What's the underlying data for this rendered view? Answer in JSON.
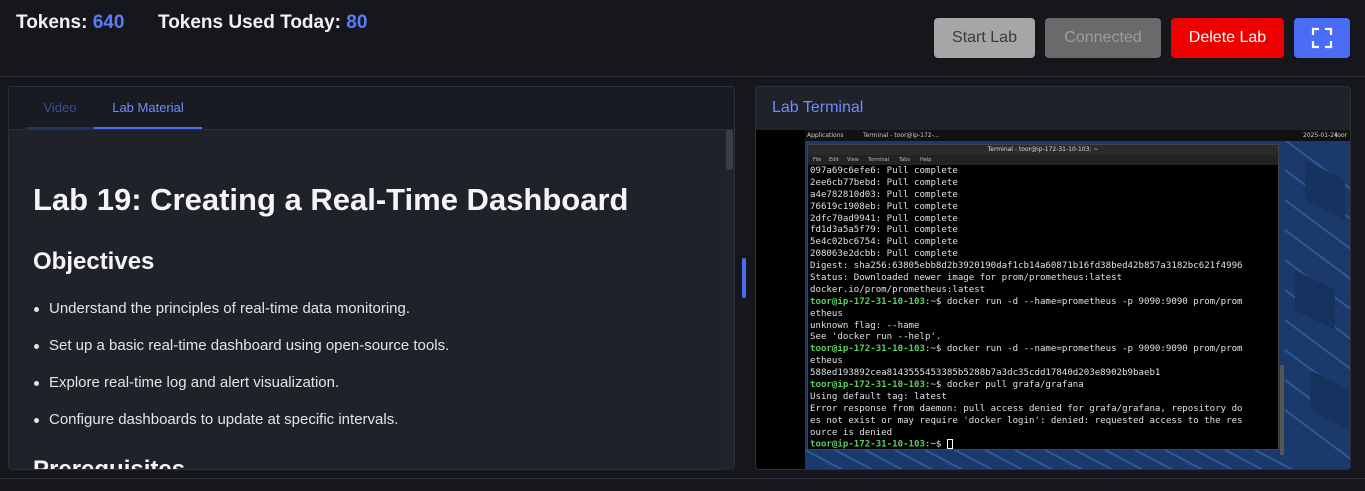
{
  "stats": {
    "tokens_label": "Tokens:",
    "tokens_value": "640",
    "used_label": "Tokens Used Today:",
    "used_value": "80"
  },
  "toolbar": {
    "start_label": "Start Lab",
    "connected_label": "Connected",
    "delete_label": "Delete Lab",
    "fullscreen_icon": "fullscreen-icon"
  },
  "tabs": [
    {
      "label": "Video"
    },
    {
      "label": "Lab Material"
    }
  ],
  "material": {
    "title": "Lab 19: Creating a Real-Time Dashboard",
    "objectives_heading": "Objectives",
    "objectives": [
      "Understand the principles of real-time data monitoring.",
      "Set up a basic real-time dashboard using open-source tools.",
      "Explore real-time log and alert visualization.",
      "Configure dashboards to update at specific intervals."
    ],
    "next_heading": "Prerequisites"
  },
  "terminal_panel": {
    "title": "Lab Terminal",
    "window_title": "Terminal - toor@ip-172-31-10-103: ~",
    "menu": [
      "File",
      "Edit",
      "View",
      "Terminal",
      "Tabs",
      "Help"
    ],
    "os_bar": {
      "apps": "Applications",
      "task": "Terminal - toor@ip-172-...",
      "date": "2025-01-24",
      "user": "toor"
    },
    "prompt": "toor@ip-172-31-10-103",
    "prompt_suffix": ":~$ ",
    "lines": [
      {
        "text": "097a69c6efe6: Pull complete"
      },
      {
        "text": "2ee6cb77bebd: Pull complete"
      },
      {
        "text": "a4e782810d03: Pull complete"
      },
      {
        "text": "76619c1908eb: Pull complete"
      },
      {
        "text": "2dfc70ad9941: Pull complete"
      },
      {
        "text": "fd1d3a5a5f79: Pull complete"
      },
      {
        "text": "5e4c02bc6754: Pull complete"
      },
      {
        "text": "208063e2dcbb: Pull complete"
      },
      {
        "text": "Digest: sha256:63805ebb8d2b3920190daf1cb14a60871b16fd38bed42b857a3182bc621f4996"
      },
      {
        "text": "Status: Downloaded newer image for prom/prometheus:latest"
      },
      {
        "text": "docker.io/prom/prometheus:latest"
      },
      {
        "cmd": "docker run -d --hame=prometheus -p 9090:9090 prom/prom"
      },
      {
        "text": "etheus"
      },
      {
        "text": "unknown flag: --hame"
      },
      {
        "text": "See 'docker run --help'."
      },
      {
        "cmd": "docker run -d --name=prometheus -p 9090:9090 prom/prom"
      },
      {
        "text": "etheus"
      },
      {
        "text": "588ed193892cea8143555453385b5288b7a3dc35cdd17840d203e8902b9baeb1"
      },
      {
        "cmd": "docker pull grafa/grafana"
      },
      {
        "text": "Using default tag: latest"
      },
      {
        "text": "Error response from daemon: pull access denied for grafa/grafana, repository do"
      },
      {
        "text": "es not exist or may require 'docker login': denied: requested access to the res"
      },
      {
        "text": "ource is denied"
      },
      {
        "cmd": ""
      }
    ]
  }
}
